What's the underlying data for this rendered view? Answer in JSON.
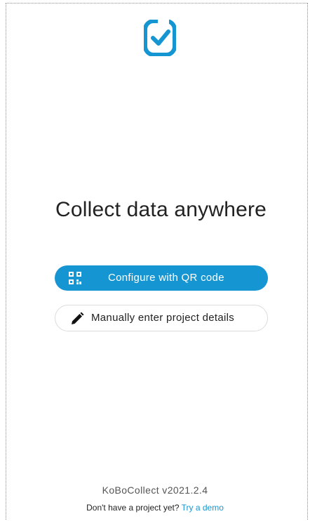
{
  "branding": {
    "logo_icon": "kobo-checkbox-icon",
    "accent_color": "#1596d2"
  },
  "main": {
    "title": "Collect data anywhere"
  },
  "actions": {
    "qr_button_label": "Configure with QR code",
    "qr_button_icon": "qr-code-icon",
    "manual_button_label": "Manually enter project details",
    "manual_button_icon": "pencil-icon"
  },
  "footer": {
    "version": "KoBoCollect v2021.2.4",
    "prompt_text": "Don't have a project yet?",
    "demo_link_label": "Try a demo"
  }
}
